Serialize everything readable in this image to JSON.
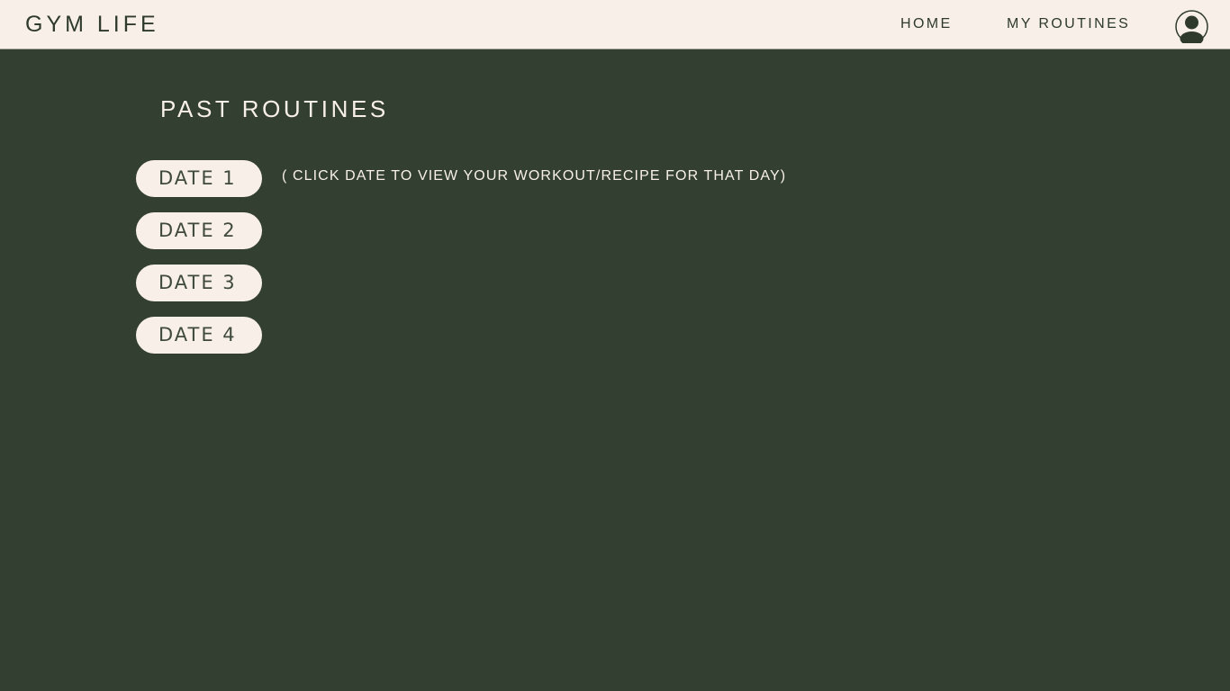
{
  "header": {
    "brand": "GYM LIFE",
    "nav": {
      "home": "HOME",
      "my_routines": "MY ROUTINES"
    },
    "avatar_icon": "user-avatar-icon"
  },
  "main": {
    "title": "PAST ROUTINES",
    "hint": "( CLICK DATE TO VIEW YOUR WORKOUT/RECIPE FOR THAT DAY)",
    "dates": [
      {
        "label": "DATE 1"
      },
      {
        "label": "DATE 2"
      },
      {
        "label": "DATE 3"
      },
      {
        "label": "DATE 4"
      }
    ]
  },
  "colors": {
    "background": "#334031",
    "header_bg": "#f8f0e8",
    "text_dark": "#2f3a2d",
    "text_light": "#f8f0e8"
  }
}
